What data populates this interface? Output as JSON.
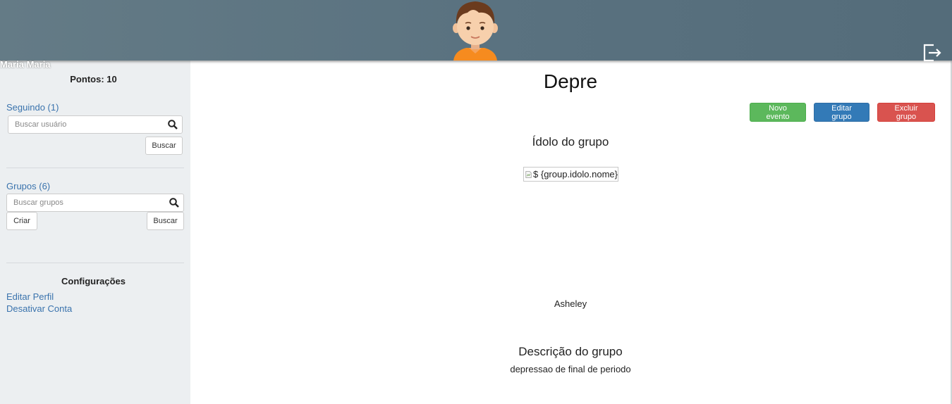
{
  "header": {
    "user_name": "Maria Maria",
    "avatar_icon": "avatar-boy-icon",
    "logout_icon": "logout-icon"
  },
  "sidebar": {
    "points": "Pontos: 10",
    "following_link": "Seguindo (1)",
    "search_users_placeholder": "Buscar usuário",
    "search_users_button": "Buscar",
    "groups_link": "Grupos (6)",
    "search_groups_placeholder": "Buscar grupos",
    "create_button": "Criar",
    "search_groups_button": "Buscar",
    "settings_title": "Configurações",
    "edit_profile_link": "Editar Perfil",
    "deactivate_account_link": "Desativar Conta"
  },
  "main": {
    "group_title": "Depre",
    "new_event_button": "Novo evento",
    "edit_group_button": "Editar grupo",
    "delete_group_button": "Excluir grupo",
    "idol_heading": "Ídolo do grupo",
    "idol_image_alt": "$ {group.idolo.nome}",
    "idol_name": "Asheley",
    "description_heading": "Descrição do grupo",
    "description_text": "depressao de final de periodo"
  },
  "colors": {
    "header": "#5a7280",
    "sidebar": "#eceff1",
    "link": "#3a73ad",
    "success": "#5cb85c",
    "primary": "#337ab7",
    "danger": "#d9534f"
  }
}
